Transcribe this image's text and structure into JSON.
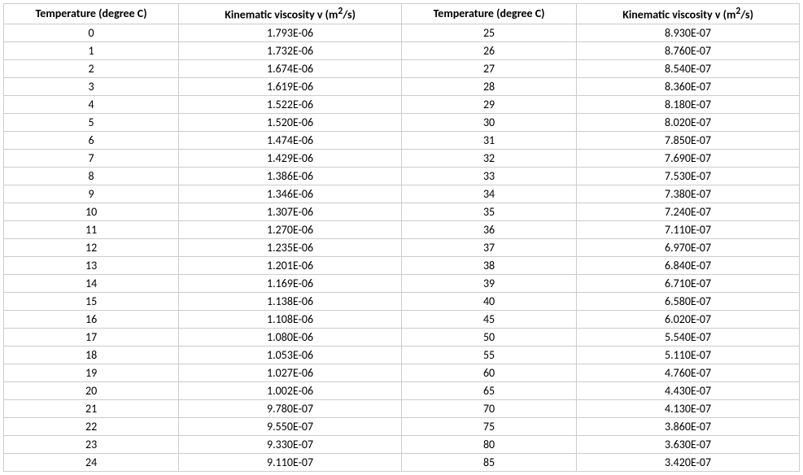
{
  "headers": {
    "temp1": "Temperature (degree C)",
    "visc1_pre": "Kinematic viscosity v (m",
    "visc1_sup": "2",
    "visc1_post": "/s)",
    "temp2": "Temperature (degree C)",
    "visc2_pre": "Kinematic viscosity v (m",
    "visc2_sup": "2",
    "visc2_post": "/s)"
  },
  "rows": [
    {
      "t1": "0",
      "v1": "1.793E-06",
      "t2": "25",
      "v2": "8.930E-07"
    },
    {
      "t1": "1",
      "v1": "1.732E-06",
      "t2": "26",
      "v2": "8.760E-07"
    },
    {
      "t1": "2",
      "v1": "1.674E-06",
      "t2": "27",
      "v2": "8.540E-07"
    },
    {
      "t1": "3",
      "v1": "1.619E-06",
      "t2": "28",
      "v2": "8.360E-07"
    },
    {
      "t1": "4",
      "v1": "1.522E-06",
      "t2": "29",
      "v2": "8.180E-07"
    },
    {
      "t1": "5",
      "v1": "1.520E-06",
      "t2": "30",
      "v2": "8.020E-07"
    },
    {
      "t1": "6",
      "v1": "1.474E-06",
      "t2": "31",
      "v2": "7.850E-07"
    },
    {
      "t1": "7",
      "v1": "1.429E-06",
      "t2": "32",
      "v2": "7.690E-07"
    },
    {
      "t1": "8",
      "v1": "1.386E-06",
      "t2": "33",
      "v2": "7.530E-07"
    },
    {
      "t1": "9",
      "v1": "1.346E-06",
      "t2": "34",
      "v2": "7.380E-07"
    },
    {
      "t1": "10",
      "v1": "1.307E-06",
      "t2": "35",
      "v2": "7.240E-07"
    },
    {
      "t1": "11",
      "v1": "1.270E-06",
      "t2": "36",
      "v2": "7.110E-07"
    },
    {
      "t1": "12",
      "v1": "1.235E-06",
      "t2": "37",
      "v2": "6.970E-07"
    },
    {
      "t1": "13",
      "v1": "1.201E-06",
      "t2": "38",
      "v2": "6.840E-07"
    },
    {
      "t1": "14",
      "v1": "1.169E-06",
      "t2": "39",
      "v2": "6.710E-07"
    },
    {
      "t1": "15",
      "v1": "1.138E-06",
      "t2": "40",
      "v2": "6.580E-07"
    },
    {
      "t1": "16",
      "v1": "1.108E-06",
      "t2": "45",
      "v2": "6.020E-07"
    },
    {
      "t1": "17",
      "v1": "1.080E-06",
      "t2": "50",
      "v2": "5.540E-07"
    },
    {
      "t1": "18",
      "v1": "1.053E-06",
      "t2": "55",
      "v2": "5.110E-07"
    },
    {
      "t1": "19",
      "v1": "1.027E-06",
      "t2": "60",
      "v2": "4.760E-07"
    },
    {
      "t1": "20",
      "v1": "1.002E-06",
      "t2": "65",
      "v2": "4.430E-07"
    },
    {
      "t1": "21",
      "v1": "9.780E-07",
      "t2": "70",
      "v2": "4.130E-07"
    },
    {
      "t1": "22",
      "v1": "9.550E-07",
      "t2": "75",
      "v2": "3.860E-07"
    },
    {
      "t1": "23",
      "v1": "9.330E-07",
      "t2": "80",
      "v2": "3.630E-07"
    },
    {
      "t1": "24",
      "v1": "9.110E-07",
      "t2": "85",
      "v2": "3.420E-07"
    }
  ]
}
